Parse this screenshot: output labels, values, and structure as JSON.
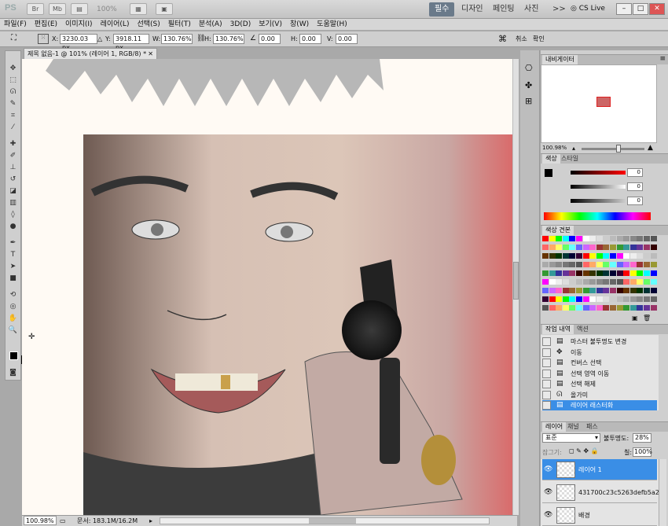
{
  "titlebar": {
    "app_logo": "PS",
    "zoom": "100%",
    "workspaces": [
      "필수",
      "디자인",
      "페인팅",
      "사진"
    ],
    "more": ">>",
    "cslive": "CS Live"
  },
  "menu": [
    "파일(F)",
    "편집(E)",
    "이미지(I)",
    "레이어(L)",
    "선택(S)",
    "필터(T)",
    "분석(A)",
    "3D(D)",
    "보기(V)",
    "창(W)",
    "도움말(H)"
  ],
  "options": {
    "x_label": "X:",
    "x_value": "3230.03 px",
    "y_label": "Y:",
    "y_value": "3918.11 px",
    "w_label": "W:",
    "w_value": "130.76%",
    "h_label": "H:",
    "h_value": "130.76%",
    "angle_value": "0.00",
    "hskew_label": "H:",
    "hskew_value": "0.00",
    "vskew_label": "V:",
    "vskew_value": "0.00",
    "cancel_label": "취소",
    "commit_label": "확인"
  },
  "document": {
    "tab_title": "제목 없음-1 @ 101% (레이어 1, RGB/8) *",
    "status_zoom": "100.98%",
    "status_doc": "문서: 183.1M/16.2M"
  },
  "navigator": {
    "tab": "내비게이터",
    "zoom": "100.98%"
  },
  "color_panel": {
    "tabs": [
      "색상",
      "스타일"
    ],
    "values": [
      "0",
      "0",
      "0"
    ]
  },
  "swatches_panel": {
    "tabs": [
      "색상 견본"
    ]
  },
  "history_panel": {
    "tabs": [
      "작업 내역",
      "액션"
    ],
    "items": [
      {
        "icon": "document-icon",
        "label": "마스터 불투명도 변경",
        "selected": false
      },
      {
        "icon": "move-icon",
        "label": "이동",
        "selected": false
      },
      {
        "icon": "document-icon",
        "label": "컨버스 선택",
        "selected": false
      },
      {
        "icon": "document-icon",
        "label": "선택 영역 이동",
        "selected": false
      },
      {
        "icon": "document-icon",
        "label": "선택 해제",
        "selected": false
      },
      {
        "icon": "lasso-icon",
        "label": "올가미",
        "selected": false
      },
      {
        "icon": "document-icon",
        "label": "레이어 래스터화",
        "selected": true
      }
    ]
  },
  "layers_panel": {
    "tabs": [
      "레이어",
      "채널",
      "패스"
    ],
    "blend_mode": "표준",
    "opacity_label": "불투명도:",
    "opacity_value": "28%",
    "lock_label": "잠그기:",
    "fill_label": "칠:",
    "fill_value": "100%",
    "layers": [
      {
        "name": "레이어 1",
        "selected": true
      },
      {
        "name": "431700c23c5263defb5a2...",
        "selected": false
      },
      {
        "name": "배경",
        "selected": false
      }
    ]
  },
  "colors": {
    "accent": "#3a8ee6"
  }
}
